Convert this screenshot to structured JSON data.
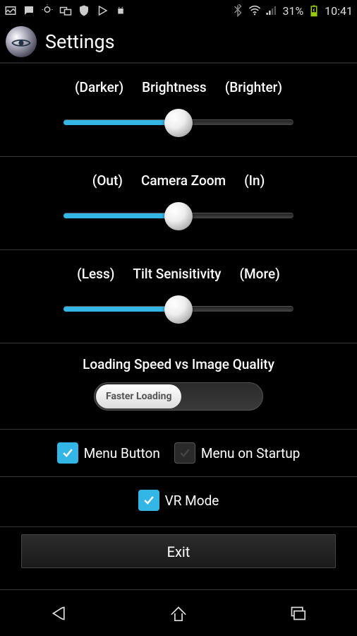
{
  "status": {
    "battery_pct": "31%",
    "time": "10:41"
  },
  "header": {
    "title": "Settings"
  },
  "sliders": {
    "brightness": {
      "left": "(Darker)",
      "label": "Brightness",
      "right": "(Brighter)",
      "value": 50
    },
    "zoom": {
      "left": "(Out)",
      "label": "Camera Zoom",
      "right": "(In)",
      "value": 50
    },
    "tilt": {
      "left": "(Less)",
      "label": "Tilt Senisitivity",
      "right": "(More)",
      "value": 50
    }
  },
  "toggle": {
    "title": "Loading Speed vs Image Quality",
    "knob_label": "Faster Loading",
    "state": "left"
  },
  "checks": {
    "menu_button": {
      "label": "Menu Button",
      "checked": true
    },
    "menu_startup": {
      "label": "Menu on Startup",
      "checked": false
    },
    "vr_mode": {
      "label": "VR Mode",
      "checked": true
    }
  },
  "exit_label": "Exit",
  "colors": {
    "accent": "#33b5e5"
  }
}
